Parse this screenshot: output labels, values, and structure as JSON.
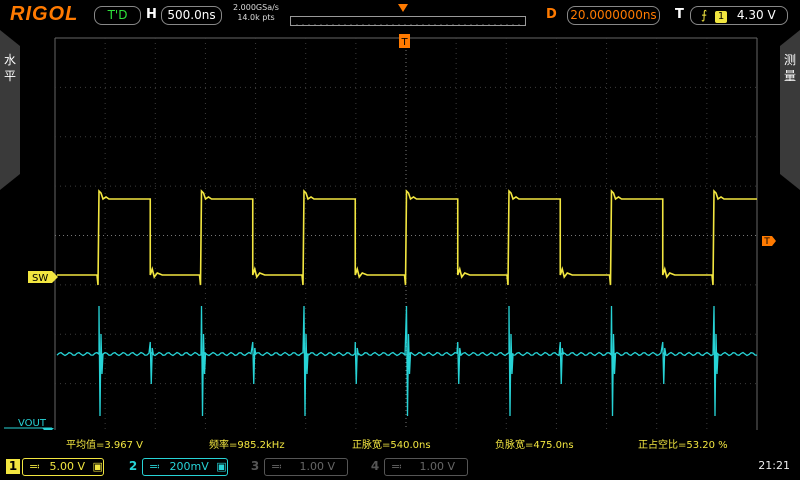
{
  "brand": "RIGOL",
  "status": "T'D",
  "timebase": {
    "letter": "H",
    "value": "500.0ns"
  },
  "sample": {
    "rate": "2.000GSa/s",
    "points": "14.0k pts"
  },
  "delay": {
    "letter": "D",
    "value": "20.0000000ns"
  },
  "trigger": {
    "letter": "T",
    "source": "1",
    "level": "4.30 V",
    "marker": "T"
  },
  "side_left": [
    "水",
    "平"
  ],
  "side_right": [
    "测",
    "量"
  ],
  "channel_labels": {
    "ch1": "SW",
    "ch2": "VOUT"
  },
  "measurements": [
    "平均值=3.967 V",
    "频率=985.2kHz",
    "正脉宽=540.0ns",
    "负脉宽=475.0ns",
    "正占空比=53.20 %"
  ],
  "channels": [
    {
      "num": "1",
      "scale": "5.00 V",
      "color": "#f2e640",
      "active": true
    },
    {
      "num": "2",
      "scale": "200mV",
      "color": "#27d3d6",
      "active": true
    },
    {
      "num": "3",
      "scale": "1.00 V",
      "color": "#555555",
      "active": false
    },
    {
      "num": "4",
      "scale": "1.00 V",
      "color": "#555555",
      "active": false
    }
  ],
  "clock": "21:21",
  "colors": {
    "accent": "#ff7a00",
    "ch1": "#f2e640",
    "ch2": "#27d3d6",
    "status": "#2ee23a"
  }
}
